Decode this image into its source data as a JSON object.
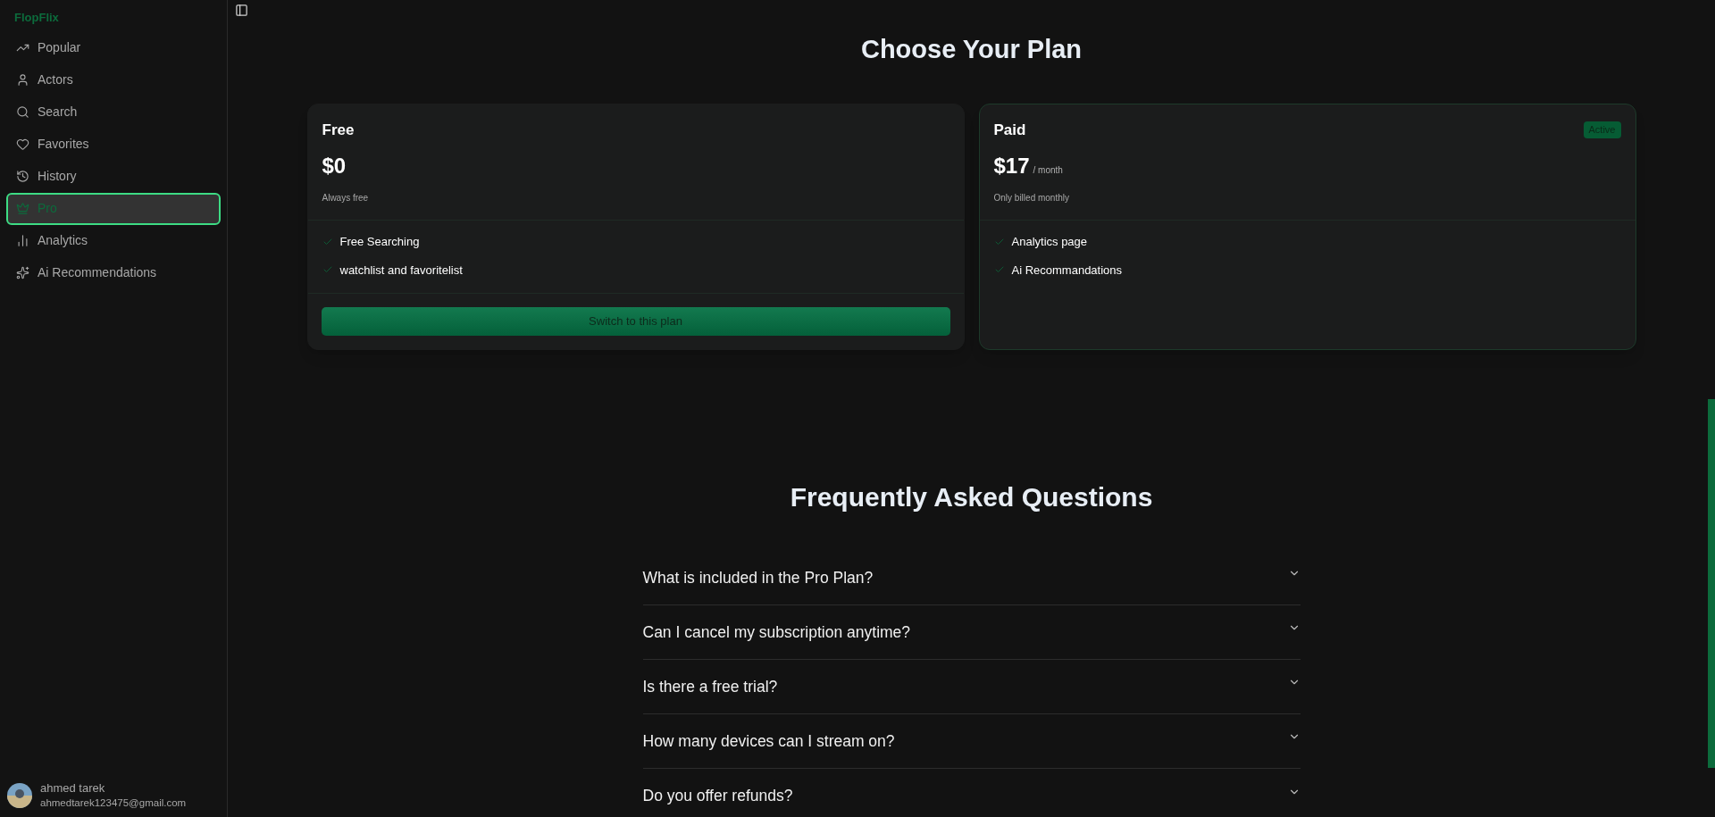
{
  "sidebar": {
    "brand": "FlopFlix",
    "items": [
      {
        "label": "Popular",
        "selected": false
      },
      {
        "label": "Actors",
        "selected": false
      },
      {
        "label": "Search",
        "selected": false
      },
      {
        "label": "Favorites",
        "selected": false
      },
      {
        "label": "History",
        "selected": false
      },
      {
        "label": "Pro",
        "selected": true
      },
      {
        "label": "Analytics",
        "selected": false
      },
      {
        "label": "Ai Recommendations",
        "selected": false
      }
    ],
    "user": {
      "name": "ahmed tarek",
      "email": "ahmedtarek123475@gmail.com"
    }
  },
  "pricing": {
    "title": "Choose Your Plan",
    "plans": [
      {
        "name": "Free",
        "price": "$0",
        "note": "Always free",
        "features": [
          "Free Searching",
          "watchlist and favoritelist"
        ],
        "active": false,
        "button": "Switch to this plan"
      },
      {
        "name": "Paid",
        "price": "$17",
        "period": "/ month",
        "note": "Only billed monthly",
        "features": [
          "Analytics page",
          "Ai Recommandations"
        ],
        "active": true
      }
    ],
    "active_label": "Active"
  },
  "faq": {
    "title": "Frequently Asked Questions",
    "questions": [
      {
        "text": "What is included in the Pro Plan?",
        "expanded": false
      },
      {
        "text": "Can I cancel my subscription anytime?",
        "expanded": false
      },
      {
        "text": "Is there a free trial?",
        "expanded": false
      },
      {
        "text": "How many devices can I stream on?",
        "expanded": false
      },
      {
        "text": "Do you offer refunds?",
        "expanded": false
      }
    ]
  }
}
